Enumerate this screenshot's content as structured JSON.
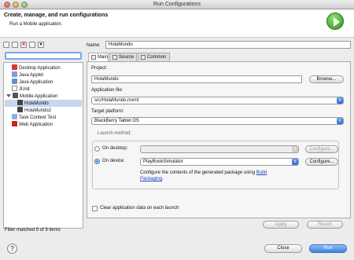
{
  "window": {
    "title": "Run Configurations"
  },
  "header": {
    "title": "Create, manage, and run configurations",
    "subtitle": "Run a Mobile application."
  },
  "left": {
    "toolbar": [
      "new-configuration",
      "duplicate",
      "delete",
      "collapse-all",
      "filter"
    ],
    "filter_placeholder": "",
    "tree": [
      {
        "label": "Desktop Application",
        "icon": "desktop-app-icon",
        "level": 0
      },
      {
        "label": "Java Applet",
        "icon": "java-applet-icon",
        "level": 0
      },
      {
        "label": "Java Application",
        "icon": "java-app-icon",
        "level": 0
      },
      {
        "label": "JUnit",
        "icon": "junit-icon",
        "level": 0
      },
      {
        "label": "Mobile Application",
        "icon": "mobile-app-icon",
        "level": 0,
        "expanded": true
      },
      {
        "label": "HolaMundo",
        "icon": "mobile-config-icon",
        "level": 1,
        "selected": true
      },
      {
        "label": "HolaMundo2",
        "icon": "mobile-config-icon",
        "level": 1
      },
      {
        "label": "Task Context Test",
        "icon": "task-context-icon",
        "level": 0
      },
      {
        "label": "Web Application",
        "icon": "web-app-icon",
        "level": 0
      }
    ],
    "status": "Filter matched 9 of 9 items"
  },
  "right": {
    "name_label": "Name:",
    "name_value": "HolaMundo",
    "tabs": [
      "Main",
      "Source",
      "Common"
    ],
    "project_label": "Project:",
    "project_value": "HolaMundo",
    "browse_label": "Browse...",
    "app_file_label": "Application file:",
    "app_file_value": "src/HolaMundo.mxml",
    "target_label": "Target platform:",
    "target_value": "BlackBerry Tablet OS",
    "launch_label": "Launch method:",
    "on_desktop_label": "On desktop:",
    "on_device_label": "On device:",
    "desktop_value": "",
    "device_value": "PlayBookSimulator",
    "configure_label": "Configure...",
    "configure_note_pre": "Configure the contents of the generated package using",
    "configure_link": "Build Packaging",
    "configure_note_post": ".",
    "clear_label": "Clear application data on each launch"
  },
  "bottom": {
    "apply": "Apply",
    "revert": "Revert"
  },
  "footer": {
    "help": "?",
    "close": "Close",
    "run": "Run"
  },
  "colors": {
    "accent": "#3f82e0",
    "selection": "#c5d6ee",
    "link": "#1a43b8"
  }
}
